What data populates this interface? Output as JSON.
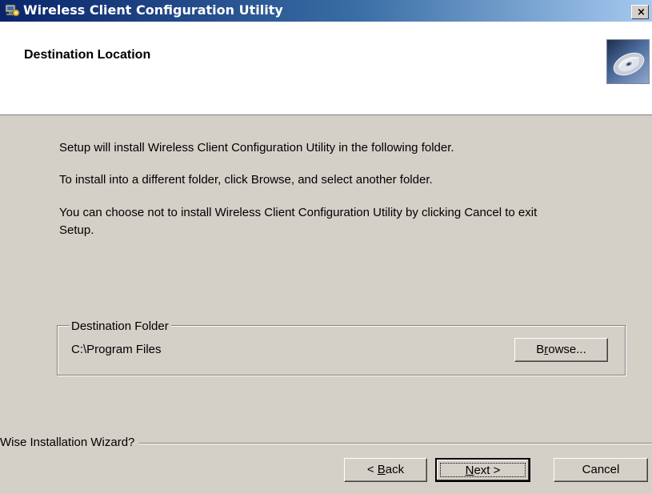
{
  "window": {
    "title": "Wireless Client Configuration Utility",
    "close_label": "×"
  },
  "header": {
    "title": "Destination Location",
    "image_icon": "cd-disc-icon"
  },
  "body": {
    "paragraph1": "Setup will install Wireless Client Configuration Utility in the following folder.",
    "paragraph2": "To install into a different folder, click Browse, and select another folder.",
    "paragraph3_line1": "You can choose not to install Wireless Client Configuration Utility by clicking Cancel to exit",
    "paragraph3_line2": "Setup."
  },
  "destination_folder": {
    "legend": "Destination Folder",
    "path": "C:\\Program Files",
    "browse_prefix": "B",
    "browse_accel": "r",
    "browse_suffix": "owse..."
  },
  "footer": {
    "label": "Wise Installation Wizard?",
    "back_prefix": "< ",
    "back_accel": "B",
    "back_suffix": "ack",
    "next_accel": "N",
    "next_suffix": "ext >",
    "cancel_label": "Cancel"
  },
  "colors": {
    "dialog_bg": "#d4d0c8",
    "titlebar_start": "#0a246a",
    "titlebar_end": "#a6caf0"
  }
}
